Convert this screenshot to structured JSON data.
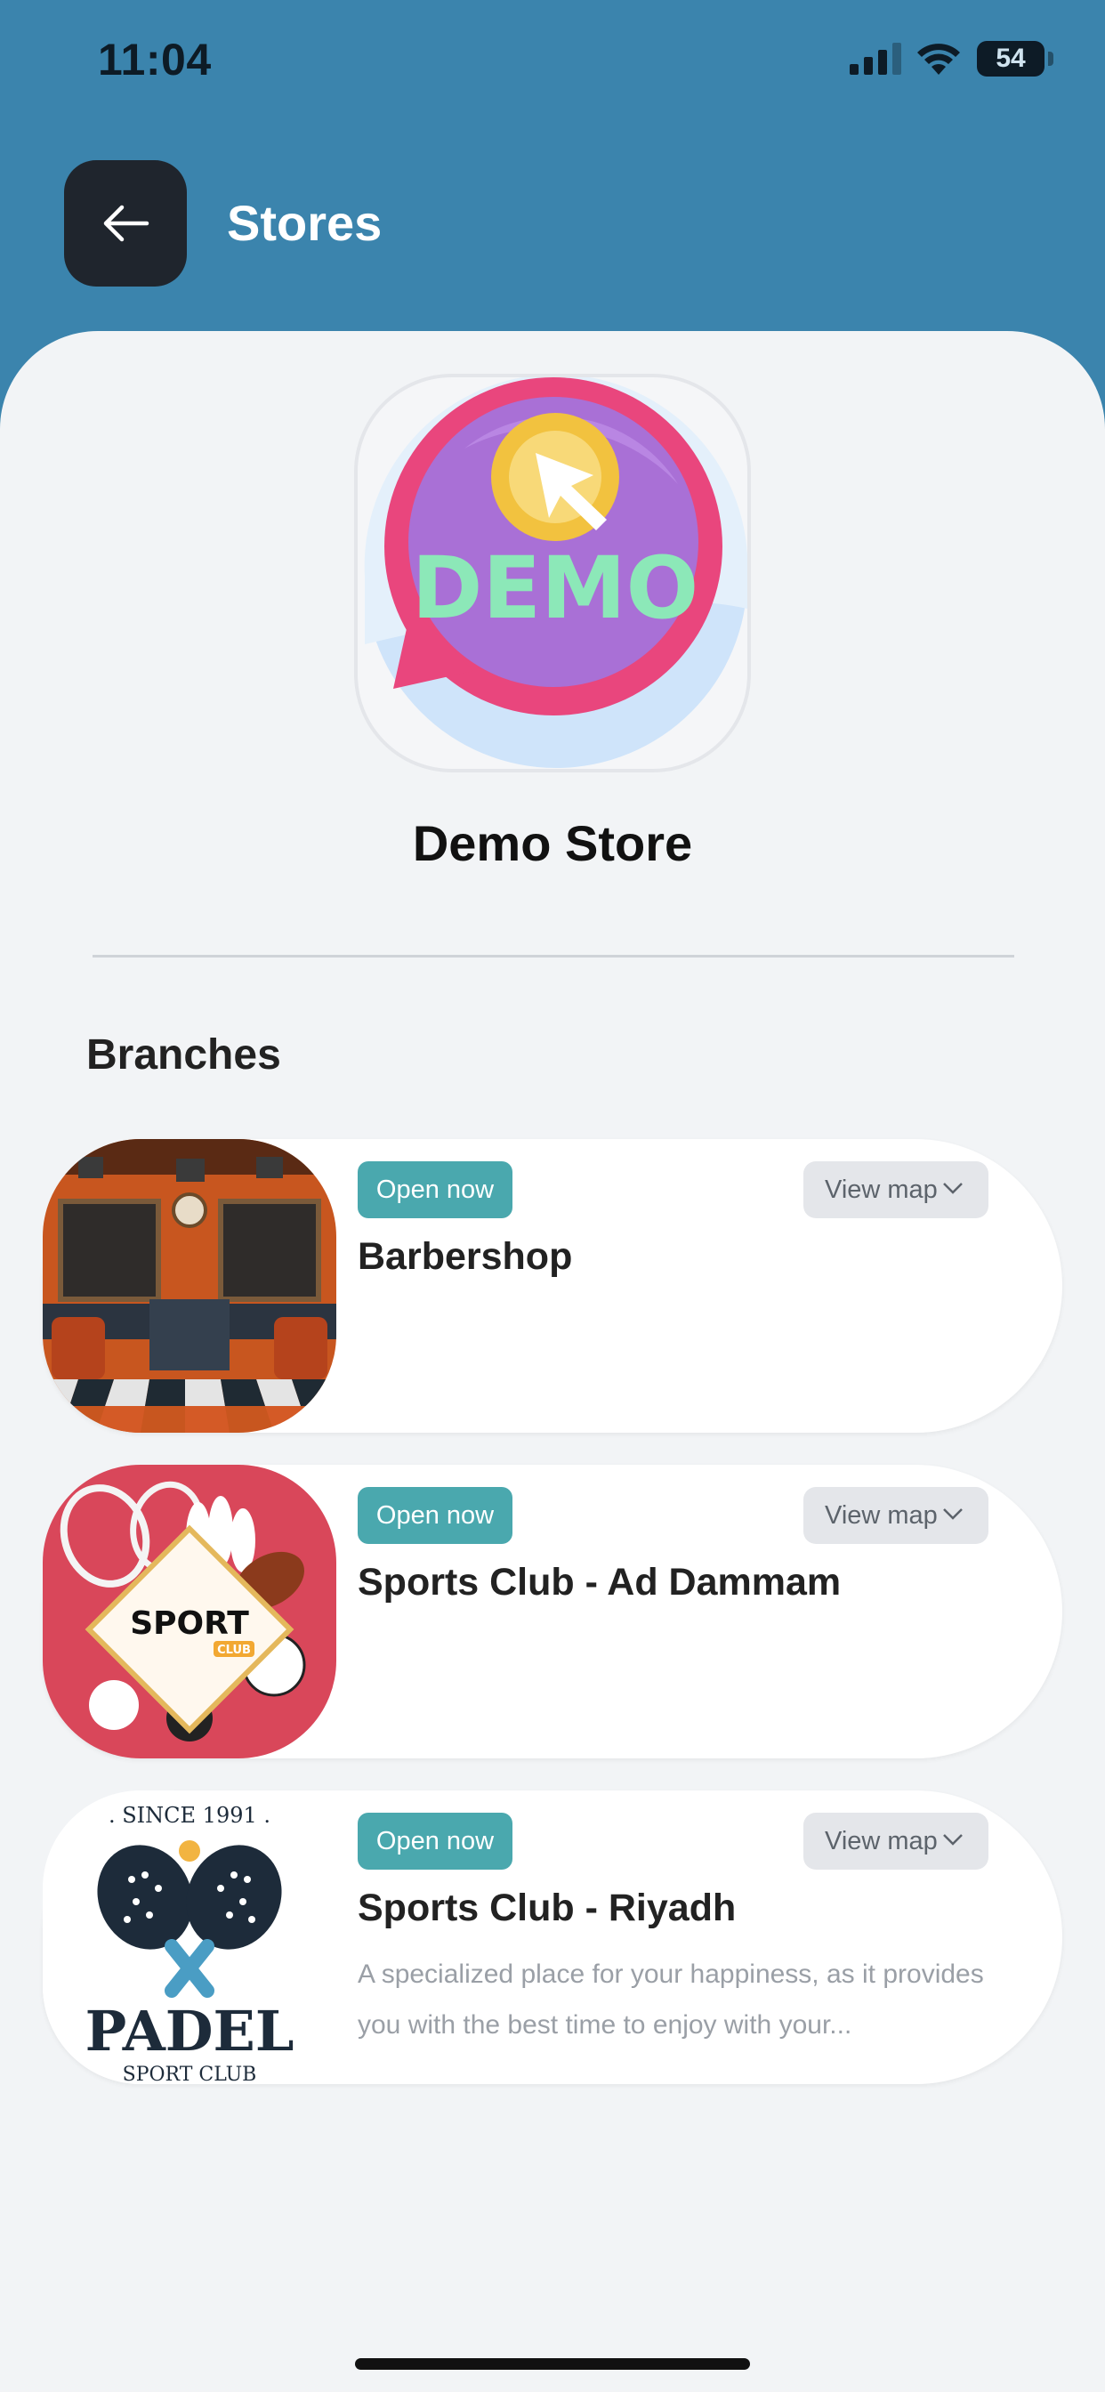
{
  "status_bar": {
    "time": "11:04",
    "battery": "54"
  },
  "header": {
    "title": "Stores",
    "back_icon": "arrow-left-icon"
  },
  "store": {
    "name": "Demo Store",
    "logo_text": "DEMO"
  },
  "branches": {
    "title": "Branches",
    "items": [
      {
        "status": "Open now",
        "map_label": "View map",
        "name": "Barbershop",
        "description": ""
      },
      {
        "status": "Open now",
        "map_label": "View map",
        "name": "Sports Club - Ad Dammam",
        "description": "",
        "logo_text": "SPORT",
        "logo_sub": "CLUB"
      },
      {
        "status": "Open now",
        "map_label": "View map",
        "name": "Sports Club - Riyadh",
        "description": "A specialized place for your happiness, as it provides you with the best time to enjoy with your...",
        "logo_top": ". SINCE 1991 .",
        "logo_text": "PADEL",
        "logo_sub": "SPORT CLUB"
      }
    ]
  },
  "colors": {
    "header_bg": "#3b84ad",
    "open_badge": "#4aa8ae",
    "sheet_bg": "#f2f4f6"
  }
}
